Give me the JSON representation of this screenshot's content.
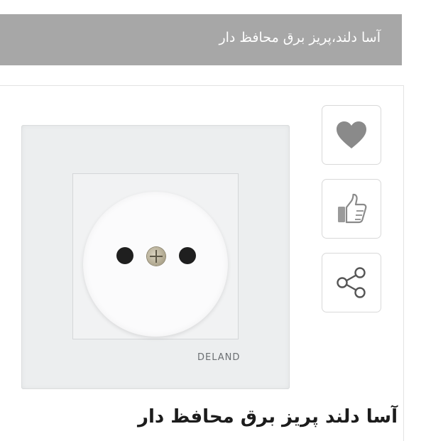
{
  "header": {
    "title": "آسا دلند،پریز برق محافظ دار"
  },
  "product_image": {
    "brand_label": "DELAND"
  },
  "actions": {
    "wishlist_icon": "heart-icon",
    "like_icon": "thumbs-up-icon",
    "share_icon": "share-icon"
  },
  "product_title_partial": "آسا دلند پریز برق محافظ دار",
  "colors": {
    "header_bg": "#a7a7a7",
    "icon_gray": "#8a8a8a"
  }
}
